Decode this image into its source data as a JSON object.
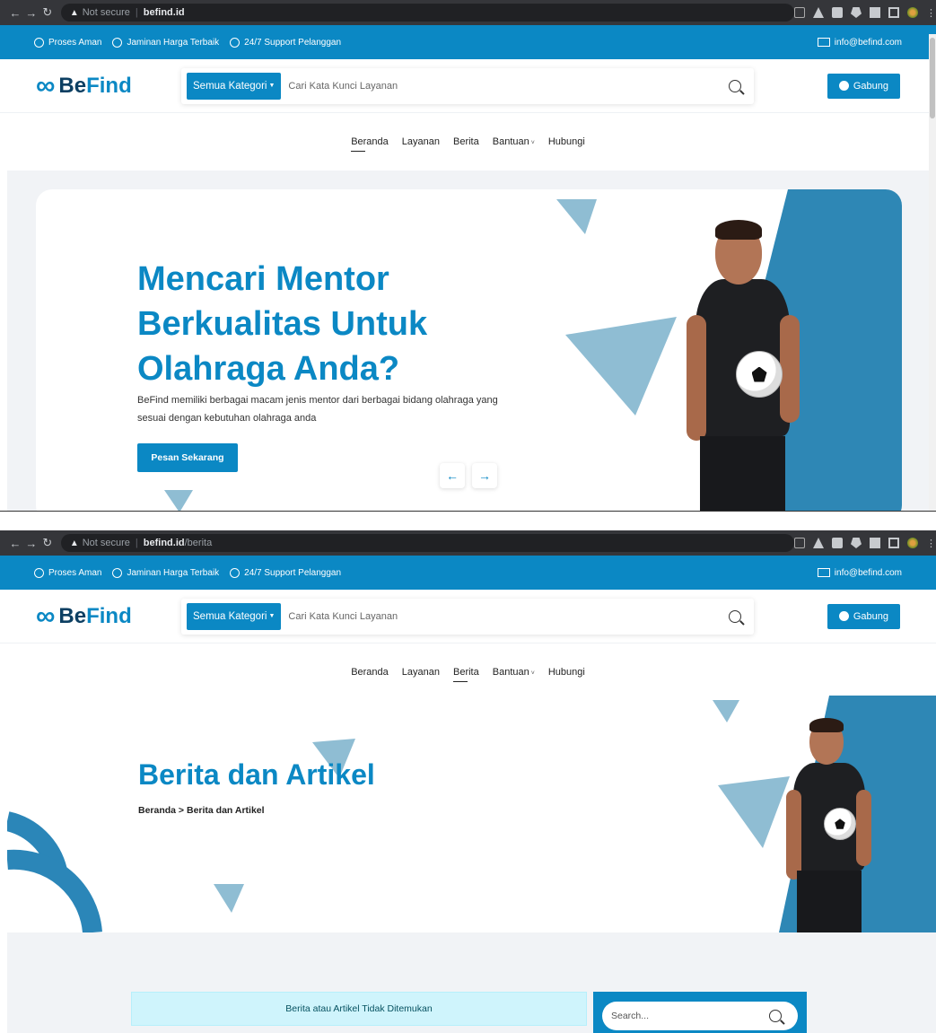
{
  "screen1": {
    "browser": {
      "not_secure": "Not secure",
      "url_host": "befind.id",
      "url_path": ""
    },
    "topbar": {
      "items": [
        "Proses Aman",
        "Jaminan Harga Terbaik",
        "24/7 Support Pelanggan"
      ],
      "email": "info@befind.com"
    },
    "header": {
      "logo_be": "Be",
      "logo_find": "Find",
      "category_button": "Semua Kategori",
      "search_placeholder": "Cari Kata Kunci Layanan",
      "join_button": "Gabung"
    },
    "nav": {
      "items": [
        "Beranda",
        "Layanan",
        "Berita",
        "Bantuan",
        "Hubungi"
      ],
      "active": "Beranda"
    },
    "hero": {
      "title_line1": "Mencari Mentor",
      "title_line2": "Berkualitas Untuk",
      "title_line3": "Olahraga Anda?",
      "description": "BeFind memiliki berbagai macam jenis mentor dari berbagai bidang olahraga yang sesuai dengan kebutuhan olahraga anda",
      "cta": "Pesan Sekarang",
      "prev_arrow": "←",
      "next_arrow": "→"
    }
  },
  "screen2": {
    "browser": {
      "not_secure": "Not secure",
      "url_host": "befind.id",
      "url_path": "/berita"
    },
    "topbar": {
      "items": [
        "Proses Aman",
        "Jaminan Harga Terbaik",
        "24/7 Support Pelanggan"
      ],
      "email": "info@befind.com"
    },
    "header": {
      "logo_be": "Be",
      "logo_find": "Find",
      "category_button": "Semua Kategori",
      "search_placeholder": "Cari Kata Kunci Layanan",
      "join_button": "Gabung"
    },
    "nav": {
      "items": [
        "Beranda",
        "Layanan",
        "Berita",
        "Bantuan",
        "Hubungi"
      ],
      "active": "Berita"
    },
    "banner": {
      "title": "Berita dan Artikel",
      "breadcrumb": "Beranda  >  Berita dan Artikel"
    },
    "content": {
      "empty_alert": "Berita atau Artikel Tidak Ditemukan",
      "sidebar_search_placeholder": "Search..."
    }
  },
  "colors": {
    "brand": "#0b88c4",
    "brand_dark": "#0c3f62",
    "accent_shape": "#2e87b5",
    "triangle": "#8fbdd3"
  }
}
